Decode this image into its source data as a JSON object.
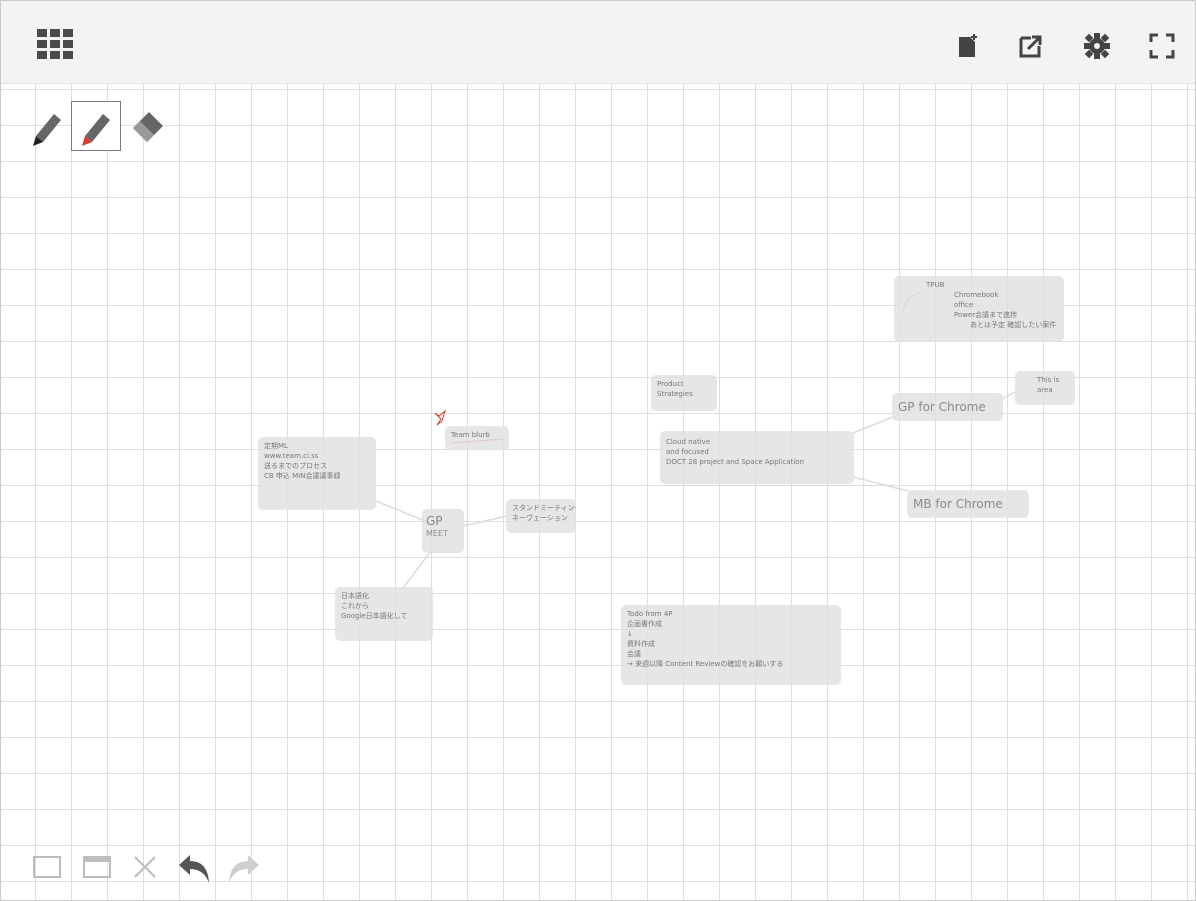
{
  "toolbar": {
    "left_icon": "grid-menu-icon",
    "right_icons": [
      "new-page-icon",
      "export-icon",
      "settings-icon",
      "fullscreen-icon"
    ]
  },
  "pen_tools": {
    "items": [
      "pencil-black-icon",
      "pencil-red-icon",
      "eraser-icon"
    ],
    "selected": "pencil-red-icon"
  },
  "bottom_tools": {
    "items": [
      "square-icon",
      "window-icon",
      "close-icon",
      "undo-icon",
      "redo-icon"
    ]
  },
  "notes": {
    "n1": {
      "lines": [
        "定期ML",
        "www.team.ci.ss",
        "送るまでのプロセス",
        "CB 申込 MIN会議議事録"
      ]
    },
    "n2": {
      "lines": [
        "GP",
        "MEET"
      ]
    },
    "n3": {
      "lines": [
        "スタンドミーティング",
        "ネーヴェーション"
      ]
    },
    "n4": {
      "lines": [
        "日本語化",
        "これから",
        "Google日本語化して"
      ]
    },
    "n5": {
      "lines": [
        "Team blurb"
      ]
    },
    "n6": {
      "lines": [
        "Product",
        "Strategies"
      ]
    },
    "n7": {
      "lines": [
        "Cloud native",
        "and focused",
        "DOCT 28 project and Space Application"
      ]
    },
    "n8": {
      "lines": [
        "GP for Chrome"
      ]
    },
    "n9": {
      "lines": [
        "MB for Chrome"
      ]
    },
    "n10": {
      "lines": [
        "This is",
        "area"
      ]
    },
    "n11": {
      "lines": [
        "TPUB",
        "Chromebook",
        "office",
        "Power会議まで進捗",
        "あとは予定 確認したい案件"
      ]
    },
    "n12": {
      "lines": [
        "Todo from 4P",
        "企画書作成",
        "↓",
        "資料作成",
        "会議",
        "→ 来週以降 Content Reviewの確認をお願いする"
      ]
    }
  },
  "colors": {
    "topbar": "#f3f3f3",
    "grid": "#dedede",
    "icon": "#444444",
    "icon_disabled": "#bdbdbd",
    "accent_red": "#d93a2b",
    "note_bg": "#e2e2e2"
  }
}
